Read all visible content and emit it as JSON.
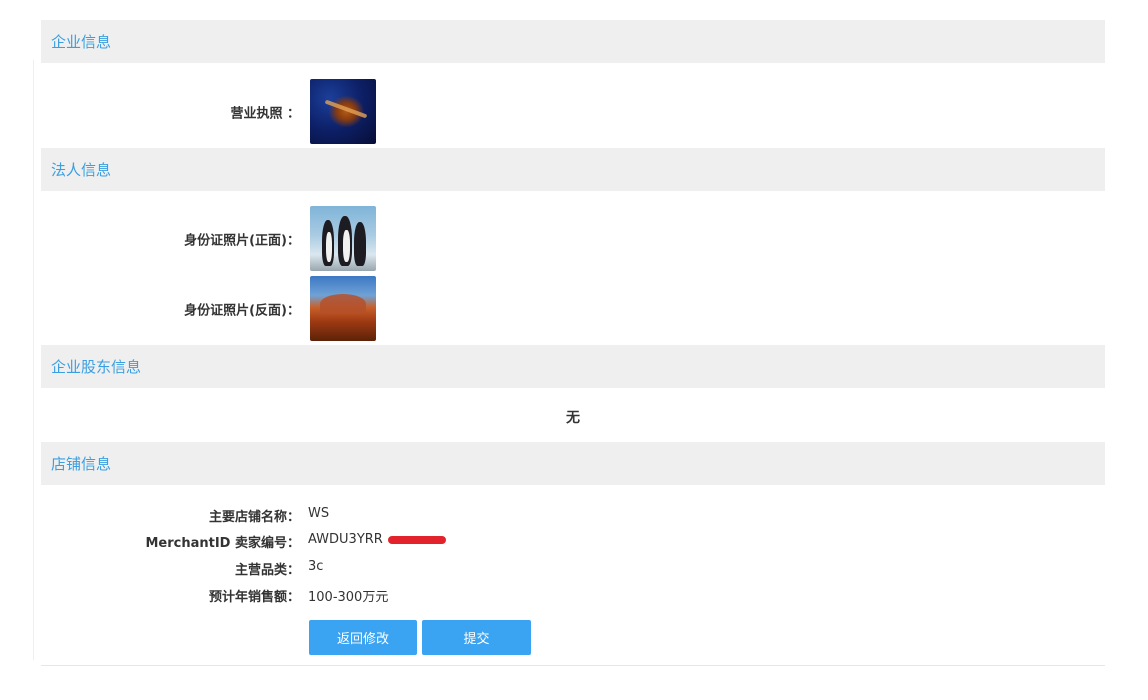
{
  "sections": {
    "company": {
      "title": "企业信息",
      "business_license_label": "营业执照 ："
    },
    "legal": {
      "title": "法人信息",
      "id_front_label": "身份证照片(正面)：",
      "id_back_label": "身份证照片(反面)："
    },
    "shareholders": {
      "title": "企业股东信息",
      "empty_text": "无"
    },
    "store": {
      "title": "店铺信息",
      "fields": [
        {
          "label": "主要店铺名称：",
          "value": "WS"
        },
        {
          "label": "MerchantID 卖家编号：",
          "value": "AWDU3YRR"
        },
        {
          "label": "主营品类：",
          "value": "3c"
        },
        {
          "label": "预计年销售额：",
          "value": "100-300万元"
        }
      ]
    }
  },
  "buttons": {
    "back_edit": "返回修改",
    "submit": "提交"
  },
  "colors": {
    "accent": "#3a9ee0",
    "button": "#3ba4f2",
    "header_bg": "#efefef",
    "redaction": "#e3232b"
  }
}
